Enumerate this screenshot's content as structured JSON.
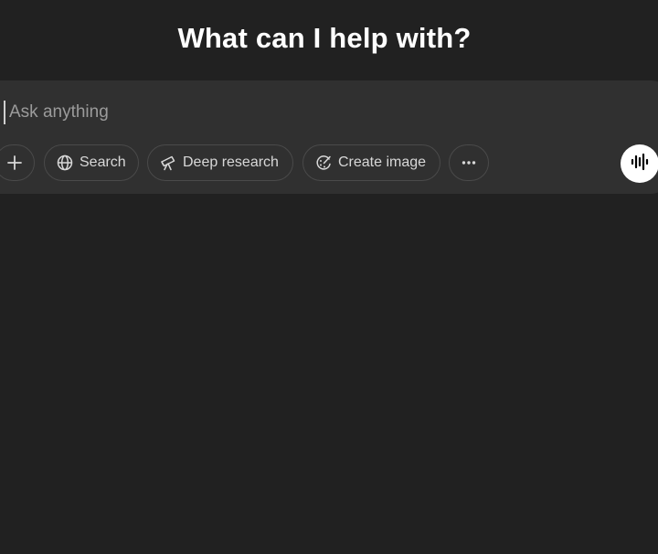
{
  "main": {
    "heading": "What can I help with?"
  },
  "composer": {
    "placeholder": "Ask anything",
    "value": ""
  },
  "toolbar": {
    "search_label": "Search",
    "deep_research_label": "Deep research",
    "create_image_label": "Create image",
    "icons": {
      "attach": "plus-icon",
      "search": "globe-icon",
      "deep_research": "telescope-icon",
      "create_image": "palette-icon",
      "more": "more-icon",
      "voice": "voice-waveform-icon"
    }
  },
  "colors": {
    "background": "#212121",
    "composer": "#303030",
    "pill_border": "#4a4a4a",
    "text": "#ececec",
    "placeholder": "#9b9b9b",
    "voice_button": "#ffffff"
  }
}
